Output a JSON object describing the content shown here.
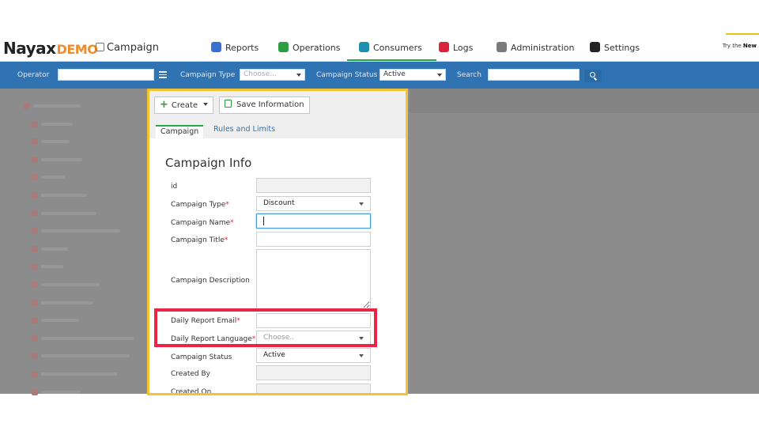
{
  "brand": {
    "logo_text": "Nayax",
    "logo_suffix": "DEMO",
    "page_title": "Campaign"
  },
  "nav": {
    "items": [
      {
        "label": "Reports",
        "icon": "chart-icon",
        "color": "#3b6fd0"
      },
      {
        "label": "Operations",
        "icon": "operations-icon",
        "color": "#2e9e44"
      },
      {
        "label": "Consumers",
        "icon": "consumers-icon",
        "color": "#1f8fb0",
        "active": true
      },
      {
        "label": "Logs",
        "icon": "logs-icon",
        "color": "#d9243b"
      },
      {
        "label": "Administration",
        "icon": "admin-icon",
        "color": "#7a7a7a"
      },
      {
        "label": "Settings",
        "icon": "gear-icon",
        "color": "#222222"
      }
    ],
    "try_new_prefix": "Try the ",
    "try_new_bold": "New"
  },
  "filters": {
    "operator_label": "Operator",
    "operator_value": "",
    "campaign_type_label": "Campaign Type",
    "campaign_type_placeholder": "Choose...",
    "campaign_status_label": "Campaign Status",
    "campaign_status_value": "Active",
    "search_label": "Search",
    "search_value": ""
  },
  "modal": {
    "create_label": "Create",
    "save_label": "Save Information",
    "tabs": [
      {
        "label": "Campaign",
        "selected": true
      },
      {
        "label": "Rules and Limits",
        "selected": false
      }
    ],
    "section_title": "Campaign Info",
    "fields": {
      "id": {
        "label": "id",
        "value": ""
      },
      "campaign_type": {
        "label": "Campaign Type",
        "value": "Discount",
        "required": true
      },
      "campaign_name": {
        "label": "Campaign Name",
        "value": "",
        "required": true
      },
      "campaign_title": {
        "label": "Campaign Title",
        "value": "",
        "required": true
      },
      "campaign_description": {
        "label": "Campaign Description",
        "value": ""
      },
      "daily_report_email": {
        "label": "Daily Report Email",
        "value": "",
        "required": true
      },
      "daily_report_language": {
        "label": "Daily Report Language",
        "placeholder": "Choose..",
        "required": true
      },
      "campaign_status": {
        "label": "Campaign Status",
        "value": "Active"
      },
      "created_by": {
        "label": "Created By",
        "value": ""
      },
      "created_on": {
        "label": "Created On",
        "value": ""
      }
    },
    "required_mark": "*"
  },
  "colors": {
    "filter_bar": "#2f73b3",
    "modal_border": "#f4c430",
    "highlight_border": "#ec2446",
    "active_tab": "#27a745",
    "required": "#e0263b"
  }
}
